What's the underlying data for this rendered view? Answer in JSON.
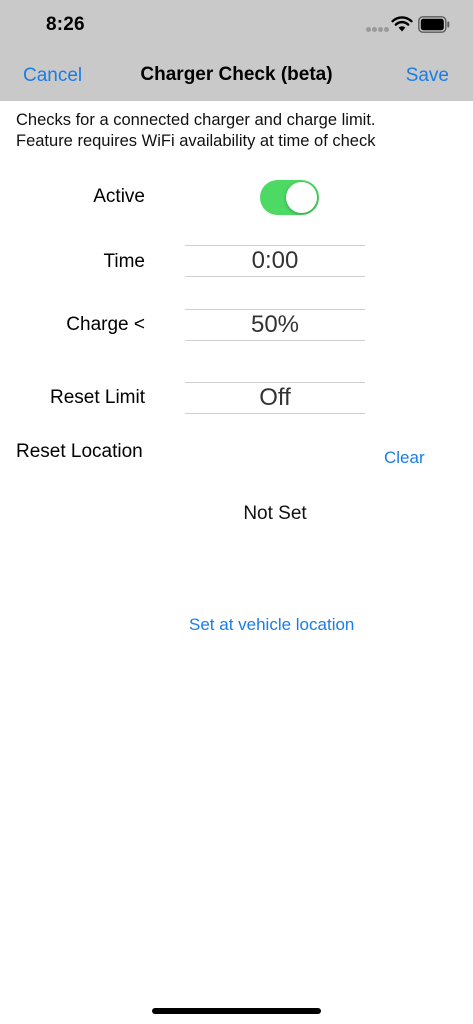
{
  "status_bar": {
    "time": "8:26"
  },
  "nav": {
    "cancel_label": "Cancel",
    "title": "Charger Check (beta)",
    "save_label": "Save"
  },
  "description": {
    "line1": "Checks for a connected charger and charge limit.",
    "line2": "Feature requires WiFi availability at time of check"
  },
  "form": {
    "active": {
      "label": "Active",
      "on": true
    },
    "time": {
      "label": "Time",
      "value": "0:00"
    },
    "charge": {
      "label": "Charge <",
      "value": "50%"
    },
    "reset_limit": {
      "label": "Reset Limit",
      "value": "Off"
    }
  },
  "reset_location": {
    "label": "Reset Location",
    "clear_label": "Clear",
    "status": "Not Set",
    "set_label": "Set at vehicle location"
  },
  "colors": {
    "accent": "#1a7de6",
    "toggle_on": "#4cd964",
    "header_bg": "#c9c9c9"
  }
}
